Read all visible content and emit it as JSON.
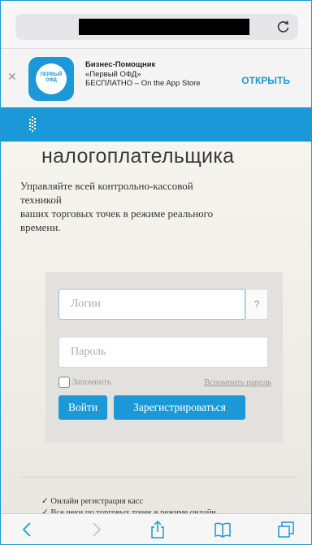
{
  "browser": {
    "address_icon": "reload-icon"
  },
  "banner": {
    "app_name": "Бизнес-Помощник",
    "app_vendor": "«Первый ОФД»",
    "app_price_store": "БЕСПЛАТНО – On the App Store",
    "open_label": "ОТКРЫТЬ",
    "icon_text_line1": "ПЕРВЫЙ",
    "icon_text_line2": "ОФД",
    "accent_color": "#1a98d8"
  },
  "page": {
    "heading": "налогоплательщика",
    "description_lines": [
      "Управляйте всей контрольно-кассовой",
      "техникой",
      "ваших торговых точек в режиме реального",
      "времени."
    ]
  },
  "login_form": {
    "login_placeholder": "Логин",
    "help_label": "?",
    "password_placeholder": "Пароль",
    "remember_label": "Запомнить",
    "forgot_label": "Вспомнить пароль",
    "login_button": "Войти",
    "register_button": "Зарегистрироваться"
  },
  "features": {
    "line1": "✓ Онлайн регистрация касс",
    "line2": "✓ Все чеки по торговых точек в режиме онлайн"
  },
  "toolbar": {
    "icons": [
      "back-icon",
      "forward-icon",
      "share-icon",
      "bookmarks-icon",
      "tabs-icon"
    ]
  }
}
